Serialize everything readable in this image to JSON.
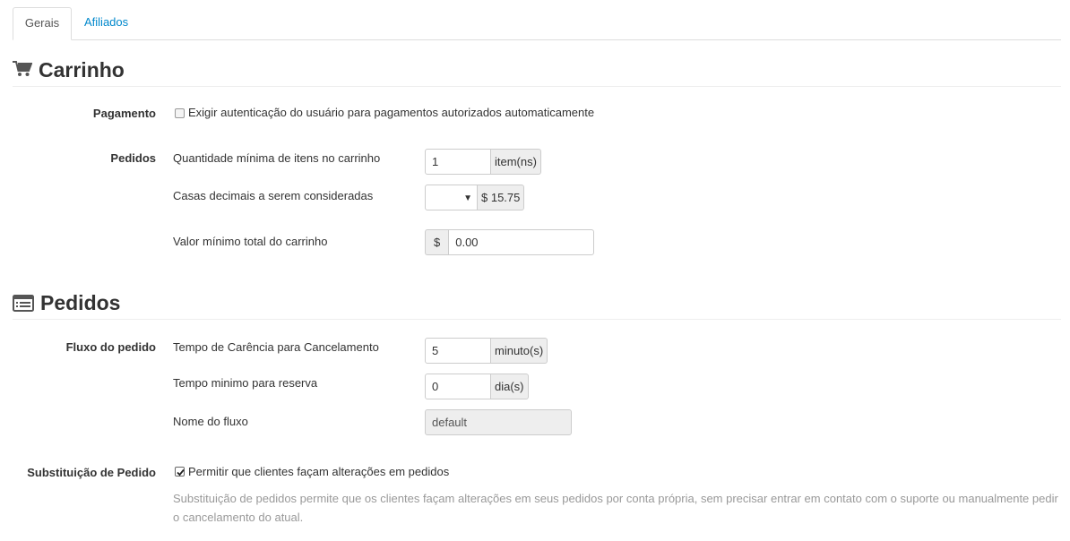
{
  "tabs": [
    {
      "label": "Gerais",
      "active": true
    },
    {
      "label": "Afiliados",
      "active": false
    }
  ],
  "cart_section": {
    "title": "Carrinho",
    "icon": "cart-icon",
    "payment": {
      "label": "Pagamento",
      "checkbox_label": "Exigir autenticação do usuário para pagamentos autorizados automaticamente",
      "checked": false
    },
    "orders": {
      "label": "Pedidos",
      "min_items_label": "Quantidade mínima de itens no carrinho",
      "min_items_value": "1",
      "min_items_unit": "item(ns)",
      "decimals_label": "Casas decimais a serem consideradas",
      "decimals_value": "",
      "decimals_preview": "$ 15.75",
      "min_total_label": "Valor mínimo total do carrinho",
      "min_total_currency": "$",
      "min_total_value": "0.00"
    }
  },
  "orders_section": {
    "title": "Pedidos",
    "icon": "list-icon",
    "flow": {
      "label": "Fluxo do pedido",
      "grace_label": "Tempo de Carência para Cancelamento",
      "grace_value": "5",
      "grace_unit": "minuto(s)",
      "reserve_label": "Tempo minimo para reserva",
      "reserve_value": "0",
      "reserve_unit": "dia(s)",
      "flow_name_label": "Nome do fluxo",
      "flow_name_value": "default"
    },
    "substitution": {
      "label": "Substituição de Pedido",
      "checkbox_label": "Permitir que clientes façam alterações em pedidos",
      "checked": true,
      "help": "Substituição de pedidos permite que os clientes façam alterações em seus pedidos por conta própria, sem precisar entrar em contato com o suporte ou manualmente pedir o cancelamento do atual."
    }
  },
  "colors": {
    "link": "#0088cc",
    "border": "#cccccc",
    "addon_bg": "#eeeeee",
    "help_text": "#999999"
  }
}
